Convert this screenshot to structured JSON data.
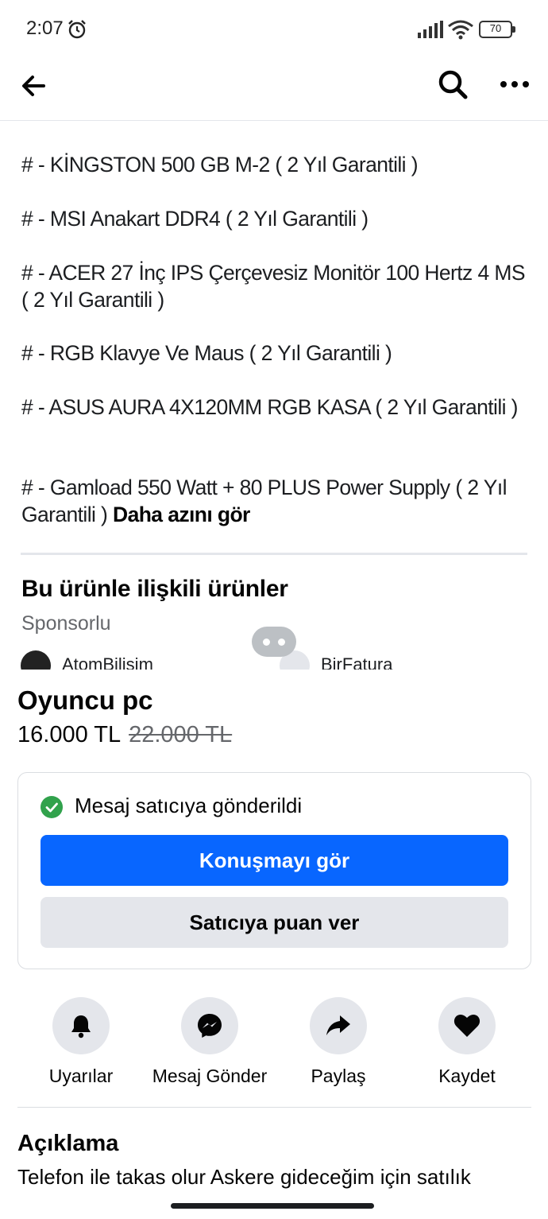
{
  "status_bar": {
    "time": "2:07",
    "battery": "70"
  },
  "nav": {
    "back_icon": "arrow-left-icon",
    "search_icon": "search-icon",
    "more_icon": "more-horizontal-icon"
  },
  "description_items": [
    "# - KİNGSTON 500 GB  M-2 ( 2 Yıl Garantili )",
    "# - MSI  Anakart DDR4 ( 2 Yıl Garantili )",
    "# - ACER 27  İnç IPS Çerçevesiz Monitör 100 Hertz 4 MS ( 2 Yıl Garantili )",
    "# - RGB Klavye Ve Maus ( 2 Yıl Garantili )",
    "# - ASUS AURA  4X120MM RGB  KASA ( 2 Yıl Garantili )",
    "# - Gamload 550 Watt + 80 PLUS Power Supply ( 2 Yıl Garantili )"
  ],
  "see_less": "Daha azını gör",
  "related": {
    "title": "Bu ürünle ilişkili ürünler",
    "sponsored": "Sponsorlu",
    "sponsors": [
      "AtomBilisim",
      "BirFatura"
    ]
  },
  "product": {
    "title": "Oyuncu pc",
    "price": "16.000 TL",
    "old_price": "22.000 TL"
  },
  "message_card": {
    "status": "Mesaj satıcıya gönderildi",
    "primary_button": "Konuşmayı gör",
    "secondary_button": "Satıcıya puan ver"
  },
  "actions": [
    {
      "label": "Uyarılar",
      "icon": "bell-icon"
    },
    {
      "label": "Mesaj Gönder",
      "icon": "messenger-icon"
    },
    {
      "label": "Paylaş",
      "icon": "share-icon"
    },
    {
      "label": "Kaydet",
      "icon": "heart-icon"
    }
  ],
  "description": {
    "title": "Açıklama",
    "text": "Telefon ile takas olur Askere gideceğim için satılık"
  },
  "colors": {
    "primary": "#0866ff",
    "success": "#31a24c",
    "secondary_bg": "#e4e6eb"
  }
}
